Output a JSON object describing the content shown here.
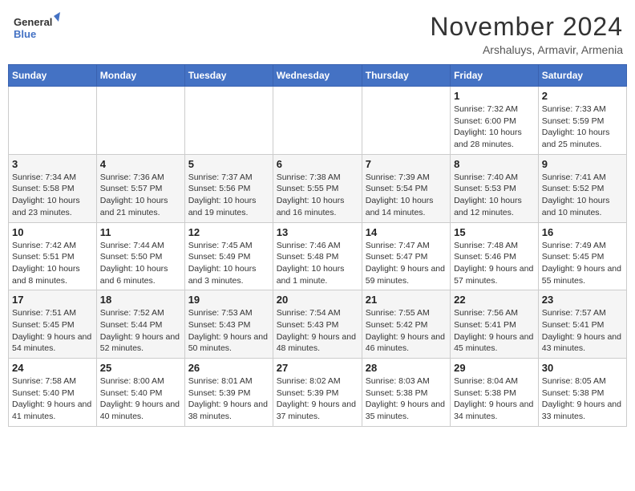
{
  "header": {
    "logo_line1": "General",
    "logo_line2": "Blue",
    "month_title": "November 2024",
    "location": "Arshaluys, Armavir, Armenia"
  },
  "weekdays": [
    "Sunday",
    "Monday",
    "Tuesday",
    "Wednesday",
    "Thursday",
    "Friday",
    "Saturday"
  ],
  "weeks": [
    [
      {
        "day": "",
        "info": ""
      },
      {
        "day": "",
        "info": ""
      },
      {
        "day": "",
        "info": ""
      },
      {
        "day": "",
        "info": ""
      },
      {
        "day": "",
        "info": ""
      },
      {
        "day": "1",
        "info": "Sunrise: 7:32 AM\nSunset: 6:00 PM\nDaylight: 10 hours and 28 minutes."
      },
      {
        "day": "2",
        "info": "Sunrise: 7:33 AM\nSunset: 5:59 PM\nDaylight: 10 hours and 25 minutes."
      }
    ],
    [
      {
        "day": "3",
        "info": "Sunrise: 7:34 AM\nSunset: 5:58 PM\nDaylight: 10 hours and 23 minutes."
      },
      {
        "day": "4",
        "info": "Sunrise: 7:36 AM\nSunset: 5:57 PM\nDaylight: 10 hours and 21 minutes."
      },
      {
        "day": "5",
        "info": "Sunrise: 7:37 AM\nSunset: 5:56 PM\nDaylight: 10 hours and 19 minutes."
      },
      {
        "day": "6",
        "info": "Sunrise: 7:38 AM\nSunset: 5:55 PM\nDaylight: 10 hours and 16 minutes."
      },
      {
        "day": "7",
        "info": "Sunrise: 7:39 AM\nSunset: 5:54 PM\nDaylight: 10 hours and 14 minutes."
      },
      {
        "day": "8",
        "info": "Sunrise: 7:40 AM\nSunset: 5:53 PM\nDaylight: 10 hours and 12 minutes."
      },
      {
        "day": "9",
        "info": "Sunrise: 7:41 AM\nSunset: 5:52 PM\nDaylight: 10 hours and 10 minutes."
      }
    ],
    [
      {
        "day": "10",
        "info": "Sunrise: 7:42 AM\nSunset: 5:51 PM\nDaylight: 10 hours and 8 minutes."
      },
      {
        "day": "11",
        "info": "Sunrise: 7:44 AM\nSunset: 5:50 PM\nDaylight: 10 hours and 6 minutes."
      },
      {
        "day": "12",
        "info": "Sunrise: 7:45 AM\nSunset: 5:49 PM\nDaylight: 10 hours and 3 minutes."
      },
      {
        "day": "13",
        "info": "Sunrise: 7:46 AM\nSunset: 5:48 PM\nDaylight: 10 hours and 1 minute."
      },
      {
        "day": "14",
        "info": "Sunrise: 7:47 AM\nSunset: 5:47 PM\nDaylight: 9 hours and 59 minutes."
      },
      {
        "day": "15",
        "info": "Sunrise: 7:48 AM\nSunset: 5:46 PM\nDaylight: 9 hours and 57 minutes."
      },
      {
        "day": "16",
        "info": "Sunrise: 7:49 AM\nSunset: 5:45 PM\nDaylight: 9 hours and 55 minutes."
      }
    ],
    [
      {
        "day": "17",
        "info": "Sunrise: 7:51 AM\nSunset: 5:45 PM\nDaylight: 9 hours and 54 minutes."
      },
      {
        "day": "18",
        "info": "Sunrise: 7:52 AM\nSunset: 5:44 PM\nDaylight: 9 hours and 52 minutes."
      },
      {
        "day": "19",
        "info": "Sunrise: 7:53 AM\nSunset: 5:43 PM\nDaylight: 9 hours and 50 minutes."
      },
      {
        "day": "20",
        "info": "Sunrise: 7:54 AM\nSunset: 5:43 PM\nDaylight: 9 hours and 48 minutes."
      },
      {
        "day": "21",
        "info": "Sunrise: 7:55 AM\nSunset: 5:42 PM\nDaylight: 9 hours and 46 minutes."
      },
      {
        "day": "22",
        "info": "Sunrise: 7:56 AM\nSunset: 5:41 PM\nDaylight: 9 hours and 45 minutes."
      },
      {
        "day": "23",
        "info": "Sunrise: 7:57 AM\nSunset: 5:41 PM\nDaylight: 9 hours and 43 minutes."
      }
    ],
    [
      {
        "day": "24",
        "info": "Sunrise: 7:58 AM\nSunset: 5:40 PM\nDaylight: 9 hours and 41 minutes."
      },
      {
        "day": "25",
        "info": "Sunrise: 8:00 AM\nSunset: 5:40 PM\nDaylight: 9 hours and 40 minutes."
      },
      {
        "day": "26",
        "info": "Sunrise: 8:01 AM\nSunset: 5:39 PM\nDaylight: 9 hours and 38 minutes."
      },
      {
        "day": "27",
        "info": "Sunrise: 8:02 AM\nSunset: 5:39 PM\nDaylight: 9 hours and 37 minutes."
      },
      {
        "day": "28",
        "info": "Sunrise: 8:03 AM\nSunset: 5:38 PM\nDaylight: 9 hours and 35 minutes."
      },
      {
        "day": "29",
        "info": "Sunrise: 8:04 AM\nSunset: 5:38 PM\nDaylight: 9 hours and 34 minutes."
      },
      {
        "day": "30",
        "info": "Sunrise: 8:05 AM\nSunset: 5:38 PM\nDaylight: 9 hours and 33 minutes."
      }
    ]
  ]
}
